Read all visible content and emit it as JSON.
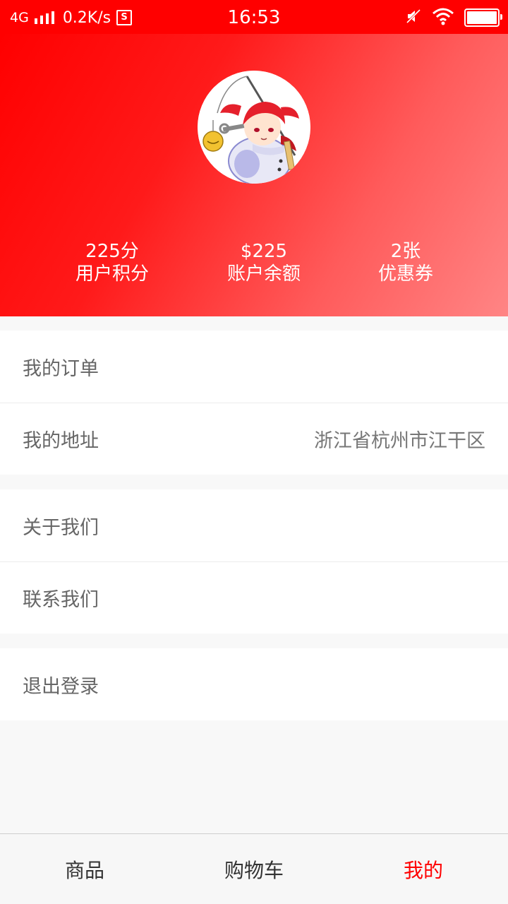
{
  "status_bar": {
    "network": "4G",
    "speed": "0.2K/s",
    "sim_label": "S",
    "time": "16:53",
    "icons": [
      "signal-icon",
      "sim-icon",
      "mute-icon",
      "wifi-icon",
      "battery-icon"
    ]
  },
  "profile": {
    "avatar": "anime-avatar",
    "stats": [
      {
        "value": "225分",
        "label": "用户积分"
      },
      {
        "value": "$225",
        "label": "账户余额"
      },
      {
        "value": "2张",
        "label": "优惠券"
      }
    ]
  },
  "menu": {
    "orders": {
      "label": "我的订单"
    },
    "address": {
      "label": "我的地址",
      "value": "浙江省杭州市江干区"
    },
    "about": {
      "label": "关于我们"
    },
    "contact": {
      "label": "联系我们"
    },
    "logout": {
      "label": "退出登录"
    }
  },
  "tabs": [
    {
      "label": "商品",
      "active": false
    },
    {
      "label": "购物车",
      "active": false
    },
    {
      "label": "我的",
      "active": true
    }
  ],
  "colors": {
    "brand": "#ff0000",
    "tab_active": "#ff0000",
    "text_muted": "#666666"
  }
}
